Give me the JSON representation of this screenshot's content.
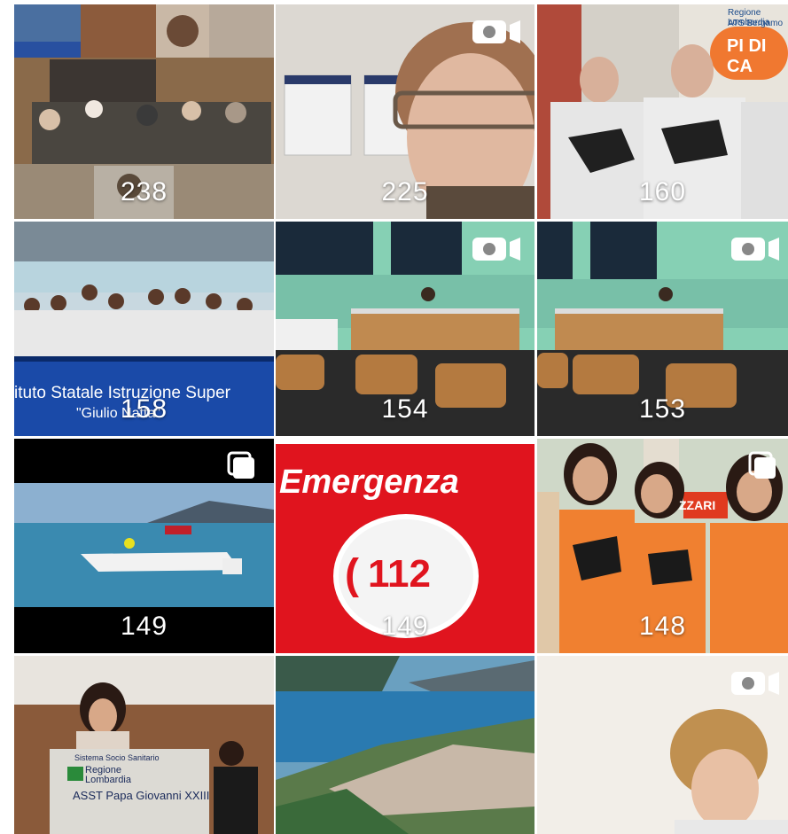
{
  "grid": {
    "tiles": [
      {
        "count": "238",
        "overlay": "none",
        "caption": "",
        "caption2": ""
      },
      {
        "count": "225",
        "overlay": "video-icon",
        "caption": "",
        "caption2": ""
      },
      {
        "count": "160",
        "overlay": "none",
        "caption": "Regione Lombardia",
        "caption2": "ATS Bergamo",
        "banner": "PI DI CA"
      },
      {
        "count": "158",
        "overlay": "none",
        "caption": "ituto Statale Istruzione Super",
        "caption2": "\"Giulio Natta\""
      },
      {
        "count": "154",
        "overlay": "video-icon",
        "caption": "",
        "caption2": ""
      },
      {
        "count": "153",
        "overlay": "video-icon",
        "caption": "",
        "caption2": ""
      },
      {
        "count": "149",
        "overlay": "multiple-icon",
        "caption": "",
        "caption2": ""
      },
      {
        "count": "149",
        "overlay": "none",
        "caption": "Emergenza",
        "caption2": "112"
      },
      {
        "count": "148",
        "overlay": "multiple-icon",
        "caption": "ZZARI",
        "caption2": ""
      },
      {
        "count": "",
        "overlay": "none",
        "caption": "Sistema Socio Sanitario",
        "caption2": "Regione Lombardia",
        "caption3": "ASST Papa Giovanni XXIII"
      },
      {
        "count": "",
        "overlay": "none",
        "caption": "",
        "caption2": ""
      },
      {
        "count": "",
        "overlay": "video-icon",
        "caption": "",
        "caption2": ""
      }
    ]
  },
  "colors": {
    "emergency_red": "#e0141e",
    "count_text": "#ffffff"
  }
}
